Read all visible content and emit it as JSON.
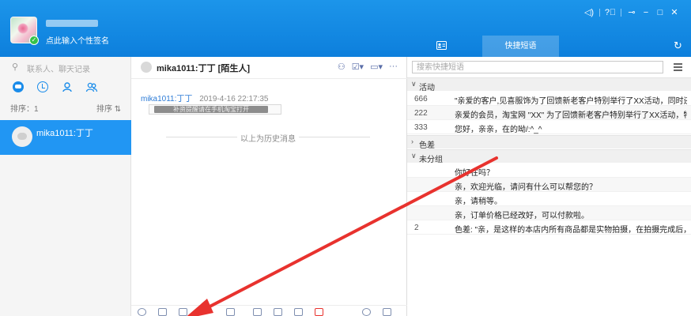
{
  "header": {
    "signature": "点此输入个性签名",
    "tabs": {
      "quick_phrases": "快捷短语"
    },
    "window_controls": [
      "volume-icon",
      "help-icon",
      "pin-icon",
      "minimize-icon",
      "maximize-icon",
      "close-icon"
    ],
    "background_color": "#1a8ae6"
  },
  "sidebar": {
    "search_placeholder": "联系人、聊天记录",
    "sort_label": "排序：1",
    "sort_toggle": "排序 ⇅",
    "contacts": [
      {
        "name": "mika1011:丁丁"
      }
    ],
    "selected_color": "#2196f3"
  },
  "chat": {
    "title": "mika1011:丁丁 [陌生人]",
    "message": {
      "sender": "mika1011:丁丁",
      "time": "2019-4-16 22:17:35",
      "text": "补资提醒请在手机淘宝打开"
    },
    "history_divider": "以上为历史消息"
  },
  "quick_phrases": {
    "search_placeholder": "搜索快捷短语",
    "groups": [
      {
        "name": "活动",
        "expanded": true,
        "items": [
          {
            "key": "666",
            "text": "\"亲爱的客户,见喜服饰为了回馈新老客户特别举行了XX活动，同时还有..."
          },
          {
            "key": "222",
            "text": "亲爱的会员，淘宝网 \"XX\" 为了回馈新老客户特别举行了XX活动，特别..."
          },
          {
            "key": "333",
            "text": "您好，亲亲，在的呦/:^_^"
          }
        ]
      },
      {
        "name": "色差",
        "expanded": false,
        "items": []
      },
      {
        "name": "未分组",
        "expanded": true,
        "items": [
          {
            "key": "",
            "text": "你好在吗？"
          },
          {
            "key": "",
            "text": "亲，欢迎光临，请问有什么可以帮您的？"
          },
          {
            "key": "",
            "text": "亲，请稍等。"
          },
          {
            "key": "",
            "text": "亲，订单价格已经改好，可以付款啦。"
          },
          {
            "key": "2",
            "text": "色差: \"亲，是这样的本店内所有商品都是实物拍摄，在拍摄完成后，已尽..."
          }
        ]
      }
    ]
  },
  "annotation": {
    "arrow_color": "#e8322e"
  }
}
